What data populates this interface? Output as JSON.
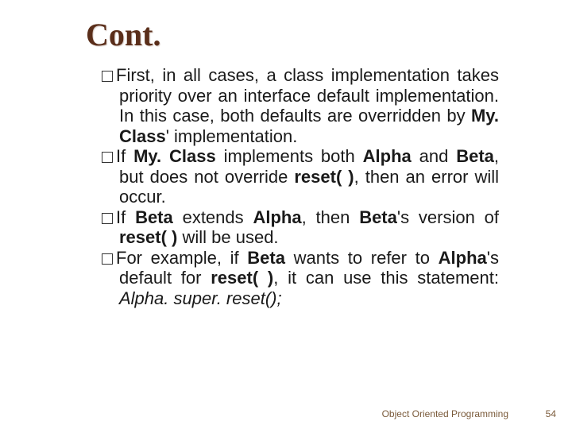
{
  "title": "Cont.",
  "bullets": [
    {
      "pre": "First, in all cases, a class implementation takes priority over an interface default implementation. In this case, both defaults are overridden by ",
      "b1": "My. Class",
      "post": "' implementation."
    },
    {
      "pre": "If ",
      "b1": "My. Class",
      "mid1": " implements both ",
      "b2": "Alpha",
      "mid2": " and ",
      "b3": "Beta",
      "mid3": ", but does not override ",
      "b4": "reset( )",
      "post": ", then an error will occur."
    },
    {
      "pre": "If ",
      "b1": "Beta",
      "mid1": " extends ",
      "b2": "Alpha",
      "mid2": ", then ",
      "b3": "Beta",
      "mid3": "'s version of ",
      "b4": "reset( )",
      "post": " will be used."
    },
    {
      "pre": "For example, if ",
      "b1": "Beta",
      "mid1": " wants to refer to ",
      "b2": "Alpha",
      "mid2": "'s default for ",
      "b3": "reset( )",
      "mid3": ", it can use this statement: ",
      "italic": "Alpha. super. reset();"
    }
  ],
  "footer": "Object Oriented Programming",
  "page": "54"
}
